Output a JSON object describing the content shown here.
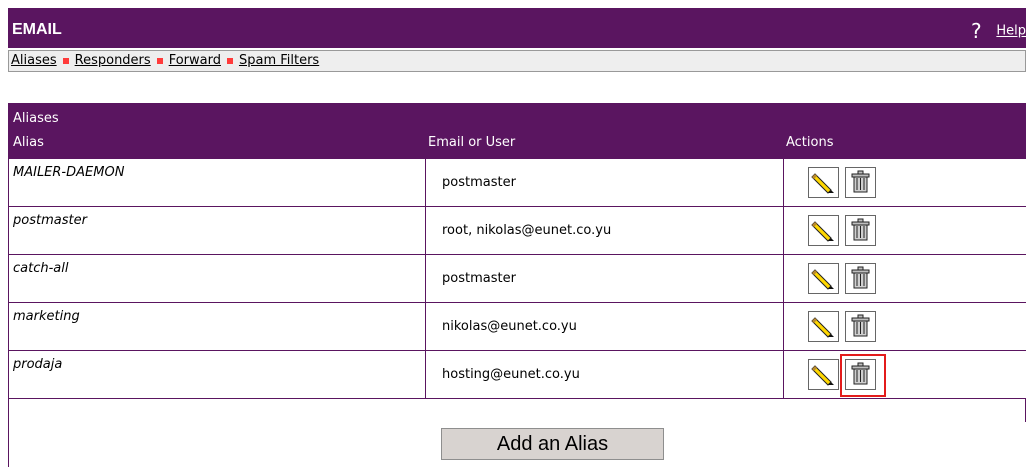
{
  "header": {
    "title": "EMAIL",
    "help_label": "Help"
  },
  "nav": {
    "items": [
      "Aliases",
      "Responders",
      "Forward",
      "Spam Filters"
    ]
  },
  "table": {
    "caption": "Aliases",
    "columns": [
      "Alias",
      "Email or User",
      "Actions"
    ],
    "rows": [
      {
        "alias": "MAILER-DAEMON",
        "email": "postmaster"
      },
      {
        "alias": "postmaster",
        "email": "root, nikolas@eunet.co.yu"
      },
      {
        "alias": "catch-all",
        "email": "postmaster"
      },
      {
        "alias": "marketing",
        "email": "nikolas@eunet.co.yu"
      },
      {
        "alias": "prodaja",
        "email": "hosting@eunet.co.yu"
      }
    ],
    "add_button": "Add an Alias"
  },
  "colors": {
    "header_bg": "#5a1560",
    "separator": "#ff3b3b",
    "highlight": "#e31b1b",
    "button_bg": "#d8d3d0"
  },
  "icons": {
    "help": "help-icon",
    "edit": "pencil-icon",
    "delete": "trash-icon"
  }
}
